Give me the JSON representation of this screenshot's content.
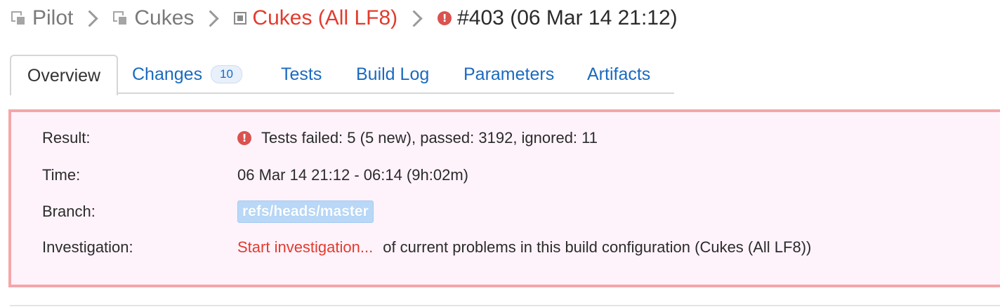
{
  "breadcrumb": {
    "project": "Pilot",
    "subproject": "Cukes",
    "build_config": "Cukes (All LF8)",
    "build": "#403 (06 Mar 14 21:12)"
  },
  "tabs": [
    {
      "label": "Overview"
    },
    {
      "label": "Changes",
      "badge": "10"
    },
    {
      "label": "Tests"
    },
    {
      "label": "Build Log"
    },
    {
      "label": "Parameters"
    },
    {
      "label": "Artifacts"
    }
  ],
  "summary": {
    "result_label": "Result:",
    "result_value": "Tests failed: 5 (5 new), passed: 3192, ignored: 11",
    "time_label": "Time:",
    "time_value": "06 Mar 14 21:12 - 06:14 (9h:02m)",
    "branch_label": "Branch:",
    "branch_value": "refs/heads/master",
    "investigation_label": "Investigation:",
    "investigation_link": "Start investigation...",
    "investigation_text": "of current problems in this build configuration (Cukes (All LF8))"
  },
  "icons": {
    "project": "project-icon",
    "build_config": "build-config-icon",
    "error": "error-icon",
    "separator": "chevron-right-icon"
  },
  "colors": {
    "link": "#1b6ac0",
    "error": "#e23b2e",
    "panel_bg": "#fff3fb",
    "panel_border": "#f4a7a9"
  }
}
